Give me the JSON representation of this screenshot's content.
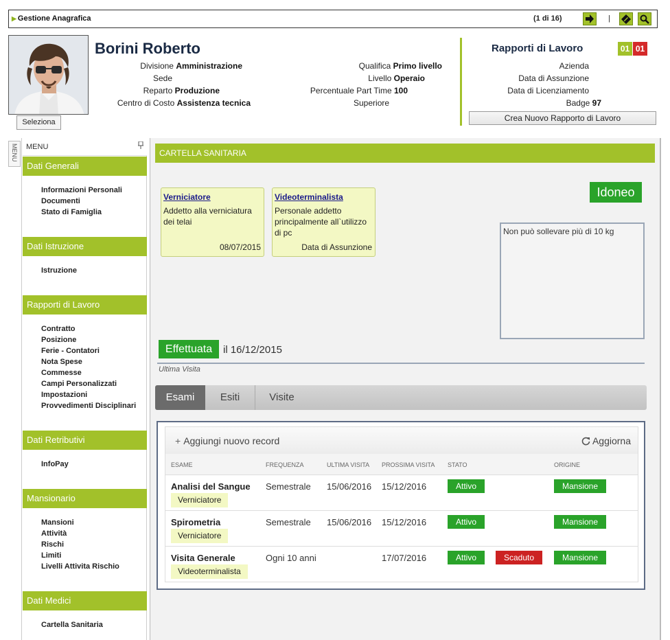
{
  "topbar": {
    "title": "Gestione Anagrafica",
    "record_count": "(1 di 16)",
    "separator": "|"
  },
  "header": {
    "name": "Borini Roberto",
    "select_label": "Seleziona",
    "left_fields": [
      {
        "label": "Divisione",
        "value": "Amministrazione"
      },
      {
        "label": "Sede",
        "value": ""
      },
      {
        "label": "Reparto",
        "value": "Produzione"
      },
      {
        "label": "Centro di Costo",
        "value": "Assistenza tecnica"
      }
    ],
    "mid_fields": [
      {
        "label": "Qualifica",
        "value": "Primo livello"
      },
      {
        "label": "Livello",
        "value": "Operaio"
      },
      {
        "label": "Percentuale Part Time",
        "value": "100"
      },
      {
        "label": "Superiore",
        "value": ""
      }
    ],
    "rapporti": {
      "title": "Rapporti di Lavoro",
      "badge_left": "01",
      "badge_right": "01",
      "fields": [
        {
          "label": "Azienda",
          "value": ""
        },
        {
          "label": "Data di Assunzione",
          "value": ""
        },
        {
          "label": "Data di Licenziamento",
          "value": ""
        },
        {
          "label": "Badge",
          "value": "97"
        }
      ],
      "new_button": "Crea Nuovo Rapporto di Lavoro"
    }
  },
  "sidebar": {
    "vertical_label": "MENU",
    "title": "MENU",
    "sections": [
      {
        "title": "Dati Generali",
        "items": [
          "Informazioni Personali",
          "Documenti",
          "Stato di Famiglia"
        ]
      },
      {
        "title": "Dati Istruzione",
        "items": [
          "Istruzione"
        ]
      },
      {
        "title": "Rapporti di Lavoro",
        "items": [
          "Contratto",
          "Posizione",
          "Ferie - Contatori",
          "Nota Spese",
          "Commesse",
          "Campi Personalizzati",
          "Impostazioni",
          "Provvedimenti Disciplinari"
        ]
      },
      {
        "title": "Dati Retributivi",
        "items": [
          "InfoPay"
        ]
      },
      {
        "title": "Mansionario",
        "items": [
          "Mansioni",
          "Attività",
          "Rischi",
          "Limiti",
          "Livelli Attivita Rischio"
        ]
      },
      {
        "title": "Dati Medici",
        "items": [
          "Cartella Sanitaria"
        ]
      }
    ]
  },
  "content": {
    "section_title": "CARTELLA SANITARIA",
    "cards": [
      {
        "title": "Verniciatore",
        "description": "Addetto alla verniciatura dei telai",
        "footer": "08/07/2015"
      },
      {
        "title": "Videoterminalista",
        "description": "Personale addetto principalmente all`utilizzo di pc",
        "footer": "Data di Assunzione"
      }
    ],
    "idoneo": "Idoneo",
    "note": "Non può sollevare più di 10 kg",
    "effettuata": "Effettuata",
    "effettuata_date": "il 16/12/2015",
    "ultima_visita": "Ultima Visita",
    "tabs": [
      "Esami",
      "Esiti",
      "Visite"
    ],
    "grid": {
      "add_label": "Aggiungi nuovo record",
      "refresh_label": "Aggiorna",
      "columns": [
        "Esame",
        "Frequenza",
        "Ultima Visita",
        "Prossima Visita",
        "Stato",
        "Origine"
      ],
      "rows": [
        {
          "esame": "Analisi del Sangue",
          "tag": "Verniciatore",
          "frequenza": "Semestrale",
          "ultima": "15/06/2016",
          "prossima": "15/12/2016",
          "stato": "Attivo",
          "scaduto": "",
          "origine": "Mansione"
        },
        {
          "esame": "Spirometria",
          "tag": "Verniciatore",
          "frequenza": "Semestrale",
          "ultima": "15/06/2016",
          "prossima": "15/12/2016",
          "stato": "Attivo",
          "scaduto": "",
          "origine": "Mansione"
        },
        {
          "esame": "Visita Generale",
          "tag": "Videoterminalista",
          "frequenza": "Ogni 10 anni",
          "ultima": "",
          "prossima": "17/07/2016",
          "stato": "Attivo",
          "scaduto": "Scaduto",
          "origine": "Mansione"
        }
      ]
    }
  },
  "colors": {
    "accent": "#a2c12a",
    "success": "#2aa32a",
    "danger": "#cc2222",
    "badge_red": "#d42a2a"
  },
  "icons": [
    "arrow-right-icon",
    "edit-icon",
    "search-icon",
    "pin-icon",
    "plus-icon",
    "refresh-icon"
  ]
}
